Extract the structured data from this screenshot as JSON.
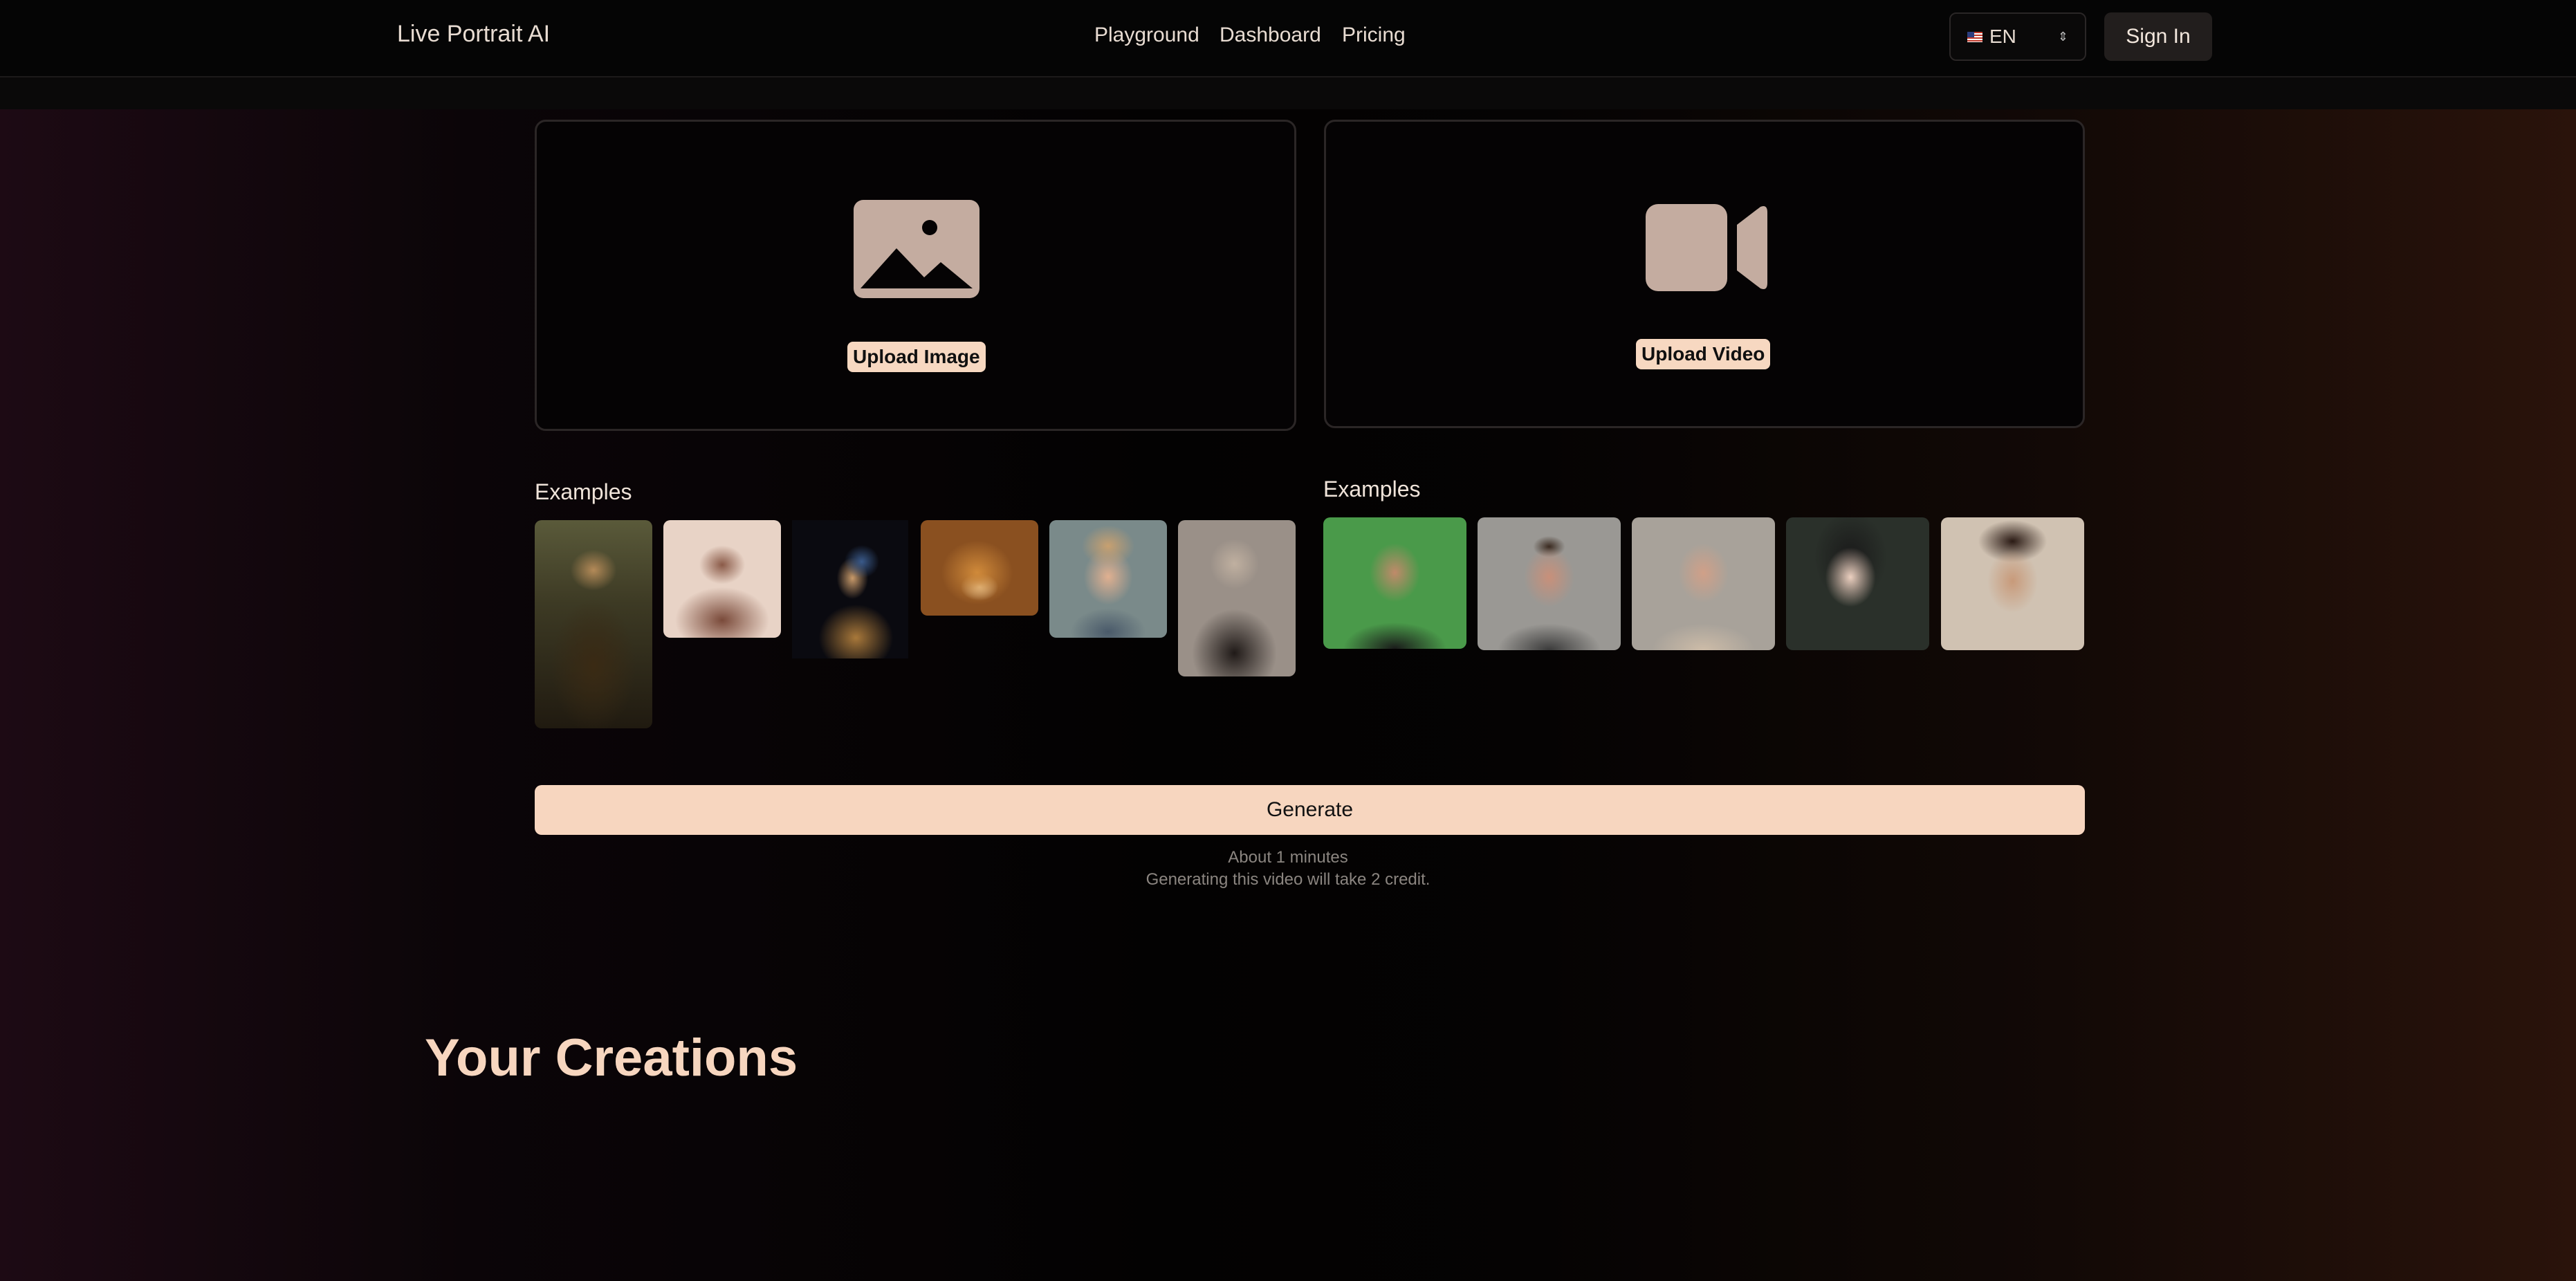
{
  "header": {
    "brand": "Live Portrait AI",
    "nav": [
      "Playground",
      "Dashboard",
      "Pricing"
    ],
    "language": {
      "flag": "us-flag-icon",
      "label": "EN"
    },
    "sign_in_label": "Sign In"
  },
  "upload": {
    "image_label": "Upload Image",
    "video_label": "Upload Video"
  },
  "examples": {
    "image_title": "Examples",
    "video_title": "Examples",
    "image_items": [
      "mona-lisa",
      "terracotta-warrior",
      "girl-with-pearl-earring",
      "doge",
      "cartoon-boy",
      "einstein"
    ],
    "video_items": [
      "man-green-screen",
      "man-open-mouth",
      "man-glasses",
      "woman-eyes-closed",
      "woman-talking"
    ]
  },
  "generate": {
    "button_label": "Generate",
    "time_note": "About 1 minutes",
    "credit_note": "Generating this video will take 2 credit."
  },
  "creations": {
    "title": "Your Creations"
  },
  "colors": {
    "accent": "#f7d6bf",
    "panel_border": "#2b2626",
    "header_bg": "#050505"
  }
}
